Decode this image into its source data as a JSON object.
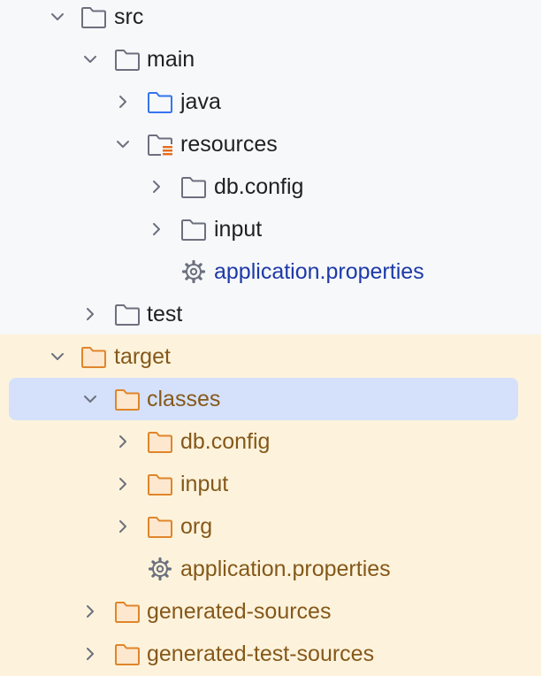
{
  "colors": {
    "panel_bg": "#f7f8fa",
    "excluded_bg": "#fdf3dc",
    "selection": "#d5e1fa",
    "text_default": "#1f2023",
    "text_link": "#1d3aa8",
    "text_excluded": "#85581a",
    "folder_gray": "#6c707e",
    "folder_blue": "#3574f0",
    "folder_orange": "#e0852a",
    "resources_accent": "#e66d17"
  },
  "tree": {
    "items": [
      {
        "label": "src",
        "icon": "folder-icon",
        "expanded": true
      },
      {
        "label": "main",
        "icon": "folder-icon",
        "expanded": true
      },
      {
        "label": "java",
        "icon": "source-folder-icon",
        "expanded": false
      },
      {
        "label": "resources",
        "icon": "resources-folder-icon",
        "expanded": true
      },
      {
        "label": "db.config",
        "icon": "folder-icon",
        "expanded": false
      },
      {
        "label": "input",
        "icon": "folder-icon",
        "expanded": false
      },
      {
        "label": "application.properties",
        "icon": "settings-gear-icon"
      },
      {
        "label": "test",
        "icon": "folder-icon",
        "expanded": false
      },
      {
        "label": "target",
        "icon": "excluded-folder-icon",
        "expanded": true
      },
      {
        "label": "classes",
        "icon": "excluded-folder-icon",
        "expanded": true,
        "selected": true
      },
      {
        "label": "db.config",
        "icon": "excluded-folder-icon",
        "expanded": false
      },
      {
        "label": "input",
        "icon": "excluded-folder-icon",
        "expanded": false
      },
      {
        "label": "org",
        "icon": "excluded-folder-icon",
        "expanded": false
      },
      {
        "label": "application.properties",
        "icon": "settings-gear-icon"
      },
      {
        "label": "generated-sources",
        "icon": "excluded-folder-icon",
        "expanded": false
      },
      {
        "label": "generated-test-sources",
        "icon": "excluded-folder-icon",
        "expanded": false
      }
    ]
  }
}
